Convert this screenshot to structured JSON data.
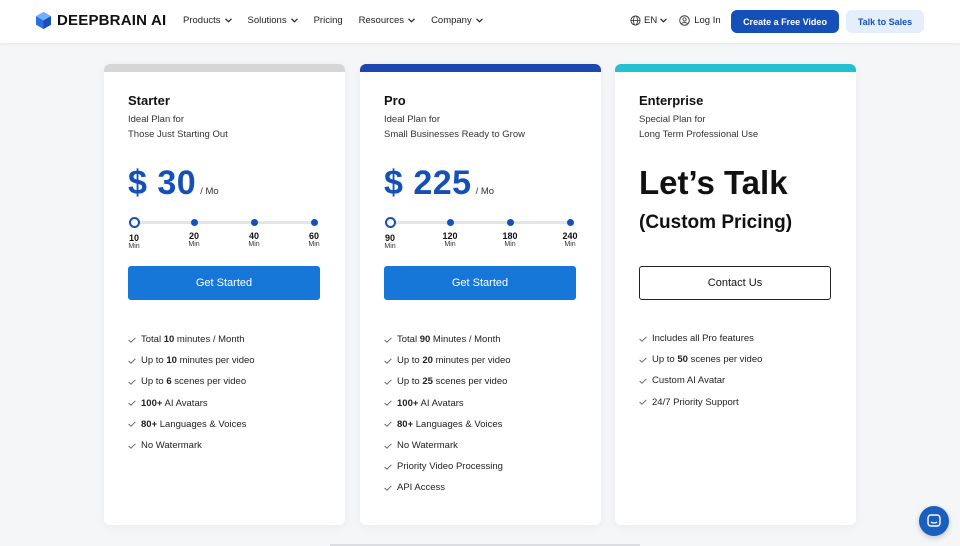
{
  "colors": {
    "brand": "#1550b8",
    "cta": "#1677d9",
    "starter_bar": "#d6d6d6",
    "pro_bar": "#1c47b0",
    "enterprise_bar": "#22c0d0"
  },
  "header": {
    "logo": "DEEPBRAIN AI",
    "nav": [
      "Products",
      "Solutions",
      "Pricing",
      "Resources",
      "Company"
    ],
    "lang": "EN",
    "login": "Log In",
    "create_button": "Create a Free Video",
    "sales_button": "Talk to Sales"
  },
  "plans": {
    "starter": {
      "name": "Starter",
      "desc_line1": "Ideal Plan for",
      "desc_line2": "Those Just Starting Out",
      "price": "$ 30",
      "unit": "/ Mo",
      "stops": [
        {
          "value": "10",
          "unit": "Min"
        },
        {
          "value": "20",
          "unit": "Min"
        },
        {
          "value": "40",
          "unit": "Min"
        },
        {
          "value": "60",
          "unit": "Min"
        }
      ],
      "selected_stop": 0,
      "cta": "Get Started",
      "features": [
        {
          "pre": "Total ",
          "bold": "10",
          "post": " minutes / Month"
        },
        {
          "pre": "Up to ",
          "bold": "10",
          "post": " minutes per video"
        },
        {
          "pre": "Up to ",
          "bold": "6",
          "post": " scenes per video"
        },
        {
          "pre": "",
          "bold": "100+",
          "post": " AI Avatars"
        },
        {
          "pre": "",
          "bold": "80+",
          "post": " Languages & Voices"
        },
        {
          "pre": "No Watermark",
          "bold": "",
          "post": ""
        }
      ]
    },
    "pro": {
      "name": "Pro",
      "desc_line1": "Ideal Plan for",
      "desc_line2": "Small Businesses Ready to Grow",
      "price": "$ 225",
      "unit": "/ Mo",
      "stops": [
        {
          "value": "90",
          "unit": "Min"
        },
        {
          "value": "120",
          "unit": "Min"
        },
        {
          "value": "180",
          "unit": "Min"
        },
        {
          "value": "240",
          "unit": "Min"
        }
      ],
      "selected_stop": 0,
      "cta": "Get Started",
      "features": [
        {
          "pre": "Total ",
          "bold": "90",
          "post": " Minutes / Month"
        },
        {
          "pre": "Up to ",
          "bold": "20",
          "post": " minutes per video"
        },
        {
          "pre": "Up to ",
          "bold": "25",
          "post": " scenes per video"
        },
        {
          "pre": "",
          "bold": "100+",
          "post": " AI Avatars"
        },
        {
          "pre": "",
          "bold": "80+",
          "post": " Languages & Voices"
        },
        {
          "pre": "No Watermark",
          "bold": "",
          "post": ""
        },
        {
          "pre": "Priority Video Processing",
          "bold": "",
          "post": ""
        },
        {
          "pre": "API Access",
          "bold": "",
          "post": ""
        }
      ]
    },
    "enterprise": {
      "name": "Enterprise",
      "desc_line1": "Special Plan for",
      "desc_line2": "Long Term Professional Use",
      "headline": "Let’s Talk",
      "subheadline": "(Custom Pricing)",
      "cta": "Contact Us",
      "features": [
        {
          "pre": "Includes all Pro features",
          "bold": "",
          "post": ""
        },
        {
          "pre": "Up to ",
          "bold": "50",
          "post": " scenes per video"
        },
        {
          "pre": "Custom AI Avatar",
          "bold": "",
          "post": ""
        },
        {
          "pre": "24/7 Priority Support",
          "bold": "",
          "post": ""
        }
      ]
    }
  }
}
